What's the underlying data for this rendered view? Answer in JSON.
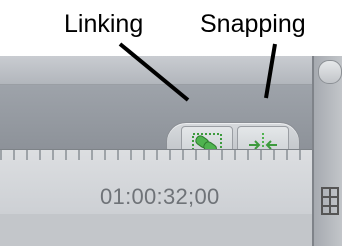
{
  "callouts": {
    "linking": "Linking",
    "snapping": "Snapping"
  },
  "toolbar": {
    "linking_icon": "linking-icon",
    "snapping_icon": "snapping-icon"
  },
  "timeline": {
    "timecode": "01:00:32;00"
  },
  "colors": {
    "toggle_active": "#3d9a3d"
  }
}
